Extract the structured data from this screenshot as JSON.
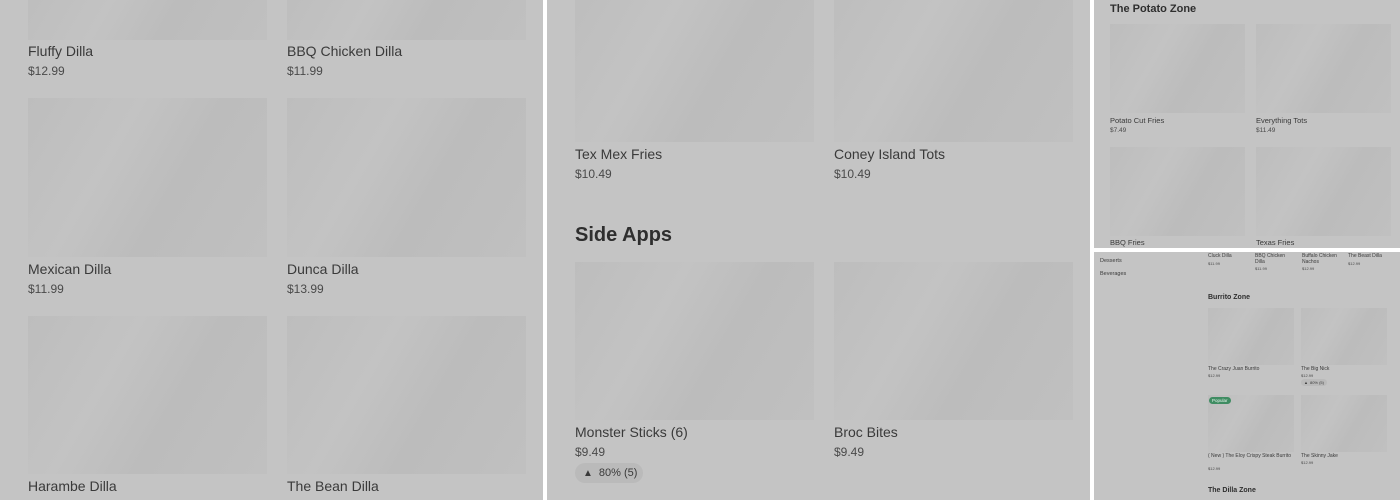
{
  "panel1": {
    "items": [
      {
        "name": "Fluffy Dilla",
        "price": "$12.99"
      },
      {
        "name": "BBQ Chicken Dilla",
        "price": "$11.99"
      },
      {
        "name": "Mexican Dilla",
        "price": "$11.99"
      },
      {
        "name": "Dunca Dilla",
        "price": "$13.99"
      },
      {
        "name": "Harambe Dilla",
        "price": ""
      },
      {
        "name": "The Bean Dilla",
        "price": ""
      }
    ]
  },
  "panel2": {
    "items": [
      {
        "name": "Tex Mex Fries",
        "price": "$10.49"
      },
      {
        "name": "Coney Island Tots",
        "price": "$10.49"
      },
      {
        "name": "Monster Sticks (6)",
        "price": "$9.49",
        "rating": "80% (5)"
      },
      {
        "name": "Broc Bites",
        "price": "$9.49"
      }
    ],
    "section_title": "Side Apps"
  },
  "panel3": {
    "section_title": "The Potato Zone",
    "items": [
      {
        "name": "Potato Cut Fries",
        "price": "$7.49"
      },
      {
        "name": "Everything Tots",
        "price": "$11.49"
      },
      {
        "name": "BBQ Fries",
        "price": ""
      },
      {
        "name": "Texas Fries",
        "price": ""
      }
    ]
  },
  "panel4": {
    "nav": [
      "Desserts",
      "Beverages"
    ],
    "top_items": [
      {
        "name": "Cluck Dilla",
        "price": "$11.99"
      },
      {
        "name": "BBQ Chicken Dilla",
        "price": "$11.99"
      },
      {
        "name": "Buffalo Chicken Nachos",
        "price": "$12.99"
      },
      {
        "name": "The Beast Dilla",
        "price": "$12.99"
      }
    ],
    "burrito_title": "Burrito Zone",
    "burrito_items": [
      {
        "name": "The Crazy Juan Burrito",
        "price": "$12.99"
      },
      {
        "name": "The Big Nick",
        "price": "$12.99",
        "rating": "80% (5)"
      },
      {
        "name": "( New ) The Eloy Crispy Steak Burrito",
        "price": "$12.99",
        "badge": "Popular"
      },
      {
        "name": "The Skinny Jake",
        "price": "$12.99"
      }
    ],
    "dilla_title": "The Dilla Zone"
  },
  "icons": {
    "thumb": "thumbs-up-icon"
  }
}
